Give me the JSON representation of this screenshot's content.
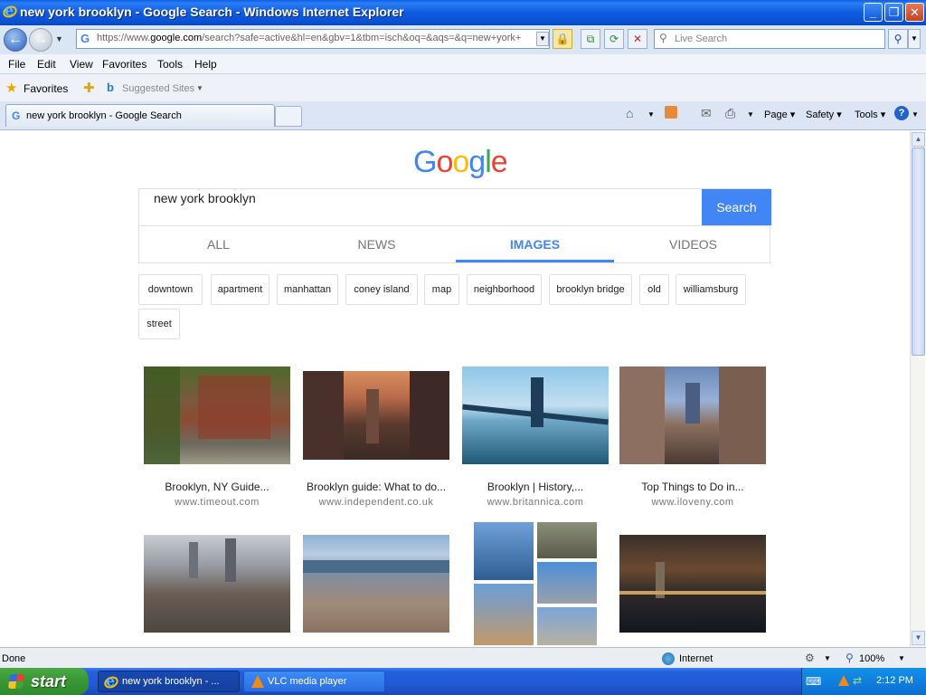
{
  "window": {
    "title": "new york brooklyn - Google Search - Windows Internet Explorer",
    "minimize": "_",
    "restore": "❐",
    "close": "✕"
  },
  "address": {
    "url_scheme": "https://www.",
    "url_domain": "google.com",
    "url_rest": "/search?safe=active&hl=en&gbv=1&tbm=isch&oq=&aqs=&q=new+york+",
    "live_search_placeholder": "Live Search"
  },
  "menu": [
    "File",
    "Edit",
    "View",
    "Favorites",
    "Tools",
    "Help"
  ],
  "favorites_bar": {
    "favorites_label": "Favorites",
    "suggested_sites_label": "Suggested Sites"
  },
  "tabs": {
    "active_tab_label": "new york brooklyn - Google Search"
  },
  "command_bar": {
    "page": "Page",
    "safety": "Safety",
    "tools": "Tools"
  },
  "google": {
    "logo_letters": [
      {
        "ch": "G",
        "color": "#4285f4"
      },
      {
        "ch": "o",
        "color": "#ea4335"
      },
      {
        "ch": "o",
        "color": "#fbbc05"
      },
      {
        "ch": "g",
        "color": "#4285f4"
      },
      {
        "ch": "l",
        "color": "#34a853"
      },
      {
        "ch": "e",
        "color": "#ea4335"
      }
    ],
    "query": "new york brooklyn",
    "search_button": "Search",
    "result_tabs": [
      {
        "label": "ALL",
        "active": false
      },
      {
        "label": "NEWS",
        "active": false
      },
      {
        "label": "IMAGES",
        "active": true
      },
      {
        "label": "VIDEOS",
        "active": false
      }
    ],
    "chips": [
      "downtown",
      "apartment",
      "manhattan",
      "coney island",
      "map",
      "neighborhood",
      "brooklyn bridge",
      "old",
      "williamsburg",
      "street"
    ],
    "results": [
      {
        "title": "Brooklyn, NY Guide...",
        "source": "www.timeout.com"
      },
      {
        "title": "Brooklyn guide: What to do...",
        "source": "www.independent.co.uk"
      },
      {
        "title": "Brooklyn | History,...",
        "source": "www.britannica.com"
      },
      {
        "title": "Top Things to Do in...",
        "source": "www.iloveny.com"
      }
    ]
  },
  "status": {
    "text": "Done",
    "zone": "Internet",
    "zoom": "100%"
  },
  "taskbar": {
    "start": "start",
    "items": [
      "new york brooklyn - ...",
      "VLC media player"
    ],
    "clock": "2:12 PM"
  }
}
